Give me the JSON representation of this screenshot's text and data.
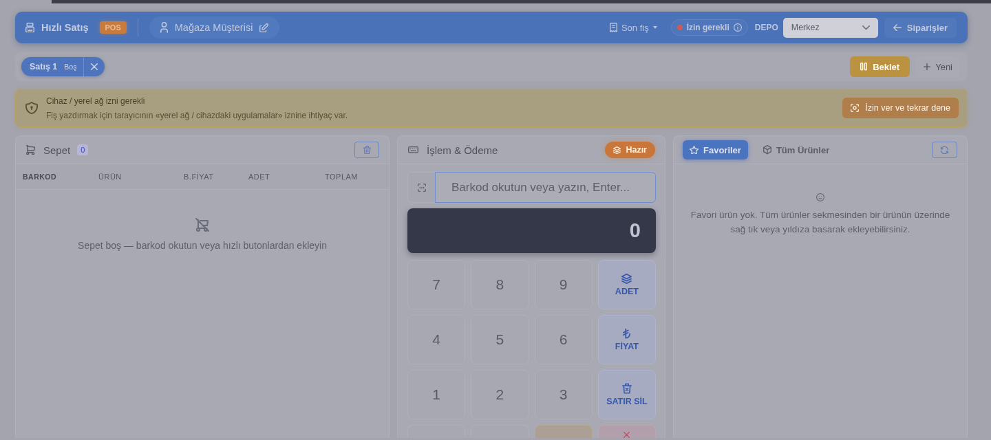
{
  "header": {
    "title": "Hızlı Satış",
    "badge": "POS",
    "customer": "Mağaza Müşterisi",
    "last_receipt": {
      "label": "Son fiş",
      "disabled": true
    },
    "permission": {
      "label": "İzin gerekli",
      "color": "#cc5b57"
    },
    "warehouse": {
      "label": "DEPO",
      "value": "Merkez"
    },
    "orders_button": "Siparişler"
  },
  "sale_tabs": [
    {
      "title": "Satış 1",
      "status": "Boş",
      "selected": true
    }
  ],
  "toolbar_actions": [
    {
      "kind": "hold",
      "label": "Beklet"
    },
    {
      "kind": "new",
      "label": "Yeni"
    }
  ],
  "alert": {
    "title": "Cihaz / yerel ağ izni gerekli",
    "message": "Fiş yazdırmak için tarayıcının «yerel ağ / cihazdaki uygulamalar» iznine ihtiyaç var.",
    "button": "İzin ver ve tekrar dene"
  },
  "cart": {
    "title": "Sepet",
    "count": "0",
    "columns": [
      "BARKOD",
      "ÜRÜN",
      "B.FİYAT",
      "ADET",
      "TOPLAM"
    ],
    "empty_message": "Sepet boş — barkod okutun veya hızlı butonlardan ekleyin"
  },
  "payment": {
    "title": "İşlem & Ödeme",
    "status": "Hazır",
    "barcode": {
      "placeholder": "Barkod okutun veya yazın, Enter..."
    },
    "display": "0",
    "keys": [
      {
        "kind": "digit",
        "label": "7"
      },
      {
        "kind": "digit",
        "label": "8"
      },
      {
        "kind": "digit",
        "label": "9"
      },
      {
        "kind": "quantity",
        "label": "ADET"
      },
      {
        "kind": "digit",
        "label": "4"
      },
      {
        "kind": "digit",
        "label": "5"
      },
      {
        "kind": "digit",
        "label": "6"
      },
      {
        "kind": "price",
        "label": "FİYAT"
      },
      {
        "kind": "digit",
        "label": "1"
      },
      {
        "kind": "digit",
        "label": "2"
      },
      {
        "kind": "digit",
        "label": "3"
      },
      {
        "kind": "delete_line",
        "label": "SATIR SİL"
      },
      {
        "kind": "plain"
      },
      {
        "kind": "plain"
      },
      {
        "kind": "warn"
      },
      {
        "kind": "cancel"
      }
    ]
  },
  "products": {
    "tabs": [
      {
        "kind": "favorites",
        "label": "Favoriler",
        "selected": true
      },
      {
        "kind": "all",
        "label": "Tüm Ürünler",
        "selected": false
      }
    ],
    "empty_message": "Favori ürün yok. Tüm ürünler sekmesinden bir ürünün üzerinde sağ tık veya yıldıza basarak ekleyebilirsiniz."
  }
}
